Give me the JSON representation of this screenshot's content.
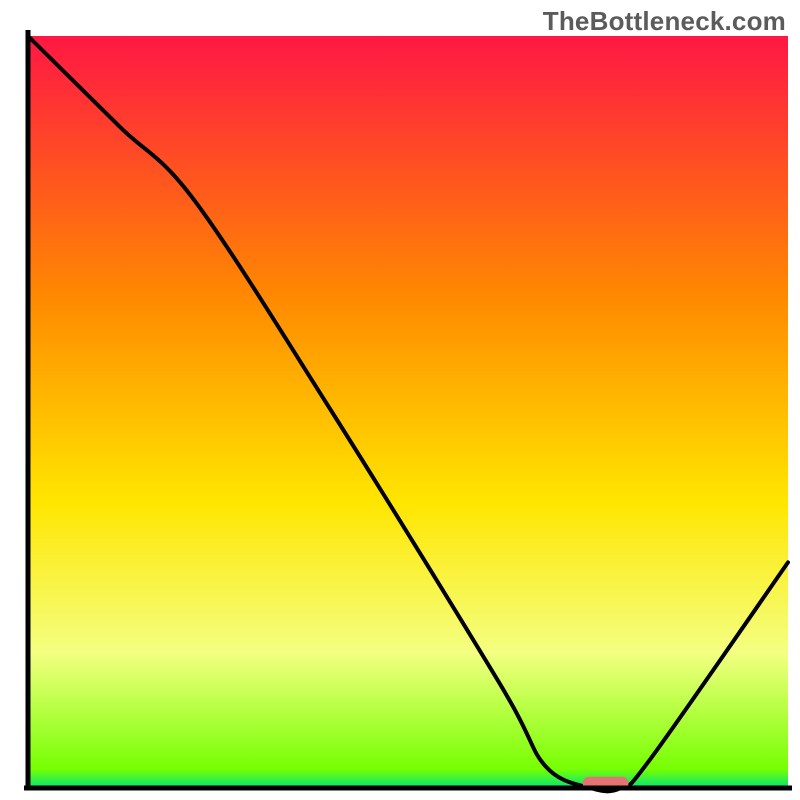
{
  "watermark": "TheBottleneck.com",
  "colors": {
    "gradient_top": "#ff1744",
    "gradient_mid1": "#ff8a00",
    "gradient_mid2": "#ffe600",
    "gradient_mid3": "#f4ff81",
    "gradient_bottom": "#00e676",
    "curve": "#000000",
    "marker": "#e57373",
    "axis": "#000000"
  },
  "chart_data": {
    "type": "line",
    "title": "",
    "xlabel": "",
    "ylabel": "",
    "xlim": [
      0,
      100
    ],
    "ylim": [
      0,
      100
    ],
    "grid": false,
    "series": [
      {
        "name": "bottleneck-curve",
        "x": [
          0,
          12,
          22,
          40,
          62,
          68,
          74,
          78,
          82,
          100
        ],
        "y": [
          100,
          88,
          78,
          50,
          14,
          3,
          0,
          0,
          4,
          30
        ]
      }
    ],
    "annotations": [
      {
        "name": "optimal-marker",
        "shape": "pill",
        "x_range": [
          73,
          79
        ],
        "y": 0.7
      }
    ],
    "background_gradient_stops": [
      {
        "offset": 0.0,
        "color": "#ff1744"
      },
      {
        "offset": 0.35,
        "color": "#ff8a00"
      },
      {
        "offset": 0.62,
        "color": "#ffe600"
      },
      {
        "offset": 0.82,
        "color": "#f4ff81"
      },
      {
        "offset": 0.975,
        "color": "#76ff03"
      },
      {
        "offset": 1.0,
        "color": "#00e676"
      }
    ]
  }
}
